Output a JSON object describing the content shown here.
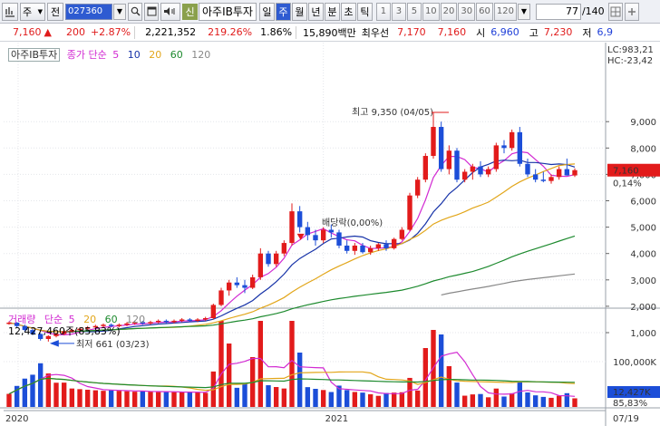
{
  "toolbar": {
    "btn1": "주",
    "btn2": "전",
    "code": "027360",
    "sin_badge": "신",
    "stock_name": "아주IB투자",
    "periods": [
      "일",
      "주",
      "월",
      "년",
      "분",
      "초",
      "틱"
    ],
    "active_period": "주",
    "num_buttons": [
      "1",
      "3",
      "5",
      "10",
      "20",
      "30",
      "60",
      "120"
    ],
    "count_value": "77",
    "count_total": "/140"
  },
  "quote": {
    "price": "7,160",
    "change_arrow": "▲",
    "change": "200",
    "change_pct": "+2.87%",
    "volume": "2,221,352",
    "volume_pct": "219.26%",
    "turnover": "1.86%",
    "amount": "15,890백만",
    "best_label": "최우선",
    "best_ask": "7,170",
    "best_bid": "7,160",
    "open_label": "시",
    "open": "6,960",
    "high_label": "고",
    "high": "7,230",
    "low_label": "저",
    "low": "6,9"
  },
  "legend": {
    "stock": "아주IB투자",
    "price_ma_label": "종가 단순",
    "ma": [
      "5",
      "10",
      "20",
      "60",
      "120"
    ],
    "volume_label": "거래량",
    "volume_ma_label": "단순",
    "vol_ma": [
      "5",
      "20",
      "60",
      "120"
    ],
    "volume_value": "12,427,460주(85,83%)"
  },
  "annotations": {
    "high": "최고 9,350 (04/05)",
    "low": "최저 661 (03/23)",
    "dividend": "배당락(0,00%)"
  },
  "right_axis": {
    "lc": "LC:983,21",
    "hc": "HC:-23,42",
    "price_ticks": [
      "9,000",
      "8,000",
      "7,000",
      "6,000",
      "5,000",
      "4,000",
      "3,000",
      "2,000",
      "1,000"
    ],
    "current_price": "7,160",
    "current_pct": "0,14%",
    "volume_tick": "100,000K",
    "current_volume": "12,427K",
    "current_vol_pct": "85,83%"
  },
  "dates": [
    "2020",
    "2021",
    "07/19"
  ],
  "colors": {
    "up": "#e21b1b",
    "down": "#1c4ed8",
    "ma5": "#d22ad2",
    "ma10": "#1733a8",
    "ma20": "#e2a61a",
    "ma60": "#1d8a2e",
    "ma120": "#888888",
    "active_period": "#2e5bd1"
  },
  "chart_data": {
    "type": "candlestick",
    "weekly_ohlc_approx": [
      [
        1350,
        1420,
        1300,
        1380
      ],
      [
        1380,
        1400,
        1200,
        1250
      ],
      [
        1250,
        1300,
        1050,
        1100
      ],
      [
        1100,
        1150,
        900,
        950
      ],
      [
        950,
        980,
        700,
        760
      ],
      [
        760,
        900,
        661,
        870
      ],
      [
        870,
        1000,
        820,
        950
      ],
      [
        950,
        1100,
        900,
        1050
      ],
      [
        1050,
        1150,
        1000,
        1100
      ],
      [
        1100,
        1200,
        1050,
        1150
      ],
      [
        1150,
        1250,
        1100,
        1200
      ],
      [
        1200,
        1300,
        1150,
        1250
      ],
      [
        1250,
        1350,
        1200,
        1300
      ],
      [
        1300,
        1350,
        1200,
        1250
      ],
      [
        1250,
        1350,
        1200,
        1300
      ],
      [
        1300,
        1400,
        1250,
        1350
      ],
      [
        1350,
        1450,
        1300,
        1400
      ],
      [
        1400,
        1450,
        1300,
        1350
      ],
      [
        1350,
        1450,
        1300,
        1400
      ],
      [
        1400,
        1500,
        1350,
        1450
      ],
      [
        1450,
        1500,
        1350,
        1400
      ],
      [
        1400,
        1500,
        1350,
        1450
      ],
      [
        1450,
        1550,
        1400,
        1500
      ],
      [
        1500,
        1550,
        1400,
        1450
      ],
      [
        1450,
        1550,
        1400,
        1500
      ],
      [
        1500,
        1600,
        1450,
        1550
      ],
      [
        1550,
        2100,
        1500,
        2050
      ],
      [
        2050,
        2700,
        2000,
        2600
      ],
      [
        2600,
        3000,
        2400,
        2900
      ],
      [
        2900,
        3100,
        2700,
        2800
      ],
      [
        2800,
        3000,
        2500,
        2700
      ],
      [
        2700,
        3200,
        2650,
        3100
      ],
      [
        3100,
        4200,
        3000,
        4000
      ],
      [
        4000,
        4100,
        3500,
        3600
      ],
      [
        3600,
        4100,
        3500,
        4000
      ],
      [
        4000,
        4500,
        3900,
        4400
      ],
      [
        4400,
        5900,
        4300,
        5600
      ],
      [
        5600,
        5800,
        4800,
        5000
      ],
      [
        5000,
        5200,
        4500,
        4700
      ],
      [
        4700,
        4900,
        4300,
        4500
      ],
      [
        4500,
        5000,
        4400,
        4900
      ],
      [
        4900,
        5100,
        4600,
        4800
      ],
      [
        4800,
        4900,
        4200,
        4300
      ],
      [
        4300,
        4500,
        4000,
        4100
      ],
      [
        4100,
        4400,
        3950,
        4300
      ],
      [
        4300,
        4400,
        4000,
        4050
      ],
      [
        4050,
        4300,
        3950,
        4200
      ],
      [
        4200,
        4400,
        4100,
        4350
      ],
      [
        4350,
        4500,
        4100,
        4200
      ],
      [
        4200,
        4600,
        4150,
        4550
      ],
      [
        4550,
        5000,
        4500,
        4900
      ],
      [
        4900,
        6300,
        4850,
        6200
      ],
      [
        6200,
        6900,
        6100,
        6800
      ],
      [
        6800,
        7800,
        6700,
        7700
      ],
      [
        7700,
        9350,
        7600,
        8800
      ],
      [
        8800,
        9000,
        7100,
        7200
      ],
      [
        7200,
        8100,
        7000,
        7900
      ],
      [
        7900,
        8000,
        6700,
        6800
      ],
      [
        6800,
        7200,
        6700,
        7100
      ],
      [
        7100,
        7400,
        6800,
        7300
      ],
      [
        7300,
        7500,
        6900,
        7000
      ],
      [
        7000,
        7300,
        6900,
        7200
      ],
      [
        7200,
        8200,
        7100,
        8100
      ],
      [
        8100,
        8300,
        7800,
        8000
      ],
      [
        8000,
        8700,
        7900,
        8600
      ],
      [
        8600,
        8800,
        7300,
        7400
      ],
      [
        7400,
        7600,
        6900,
        7000
      ],
      [
        7000,
        7200,
        6700,
        6800
      ],
      [
        6800,
        7100,
        6700,
        6750
      ],
      [
        6750,
        7000,
        6650,
        6900
      ],
      [
        6900,
        7300,
        6800,
        7200
      ],
      [
        7200,
        7600,
        6950,
        6960
      ],
      [
        6960,
        7230,
        6900,
        7160
      ]
    ],
    "ylim": [
      0,
      10000
    ]
  }
}
